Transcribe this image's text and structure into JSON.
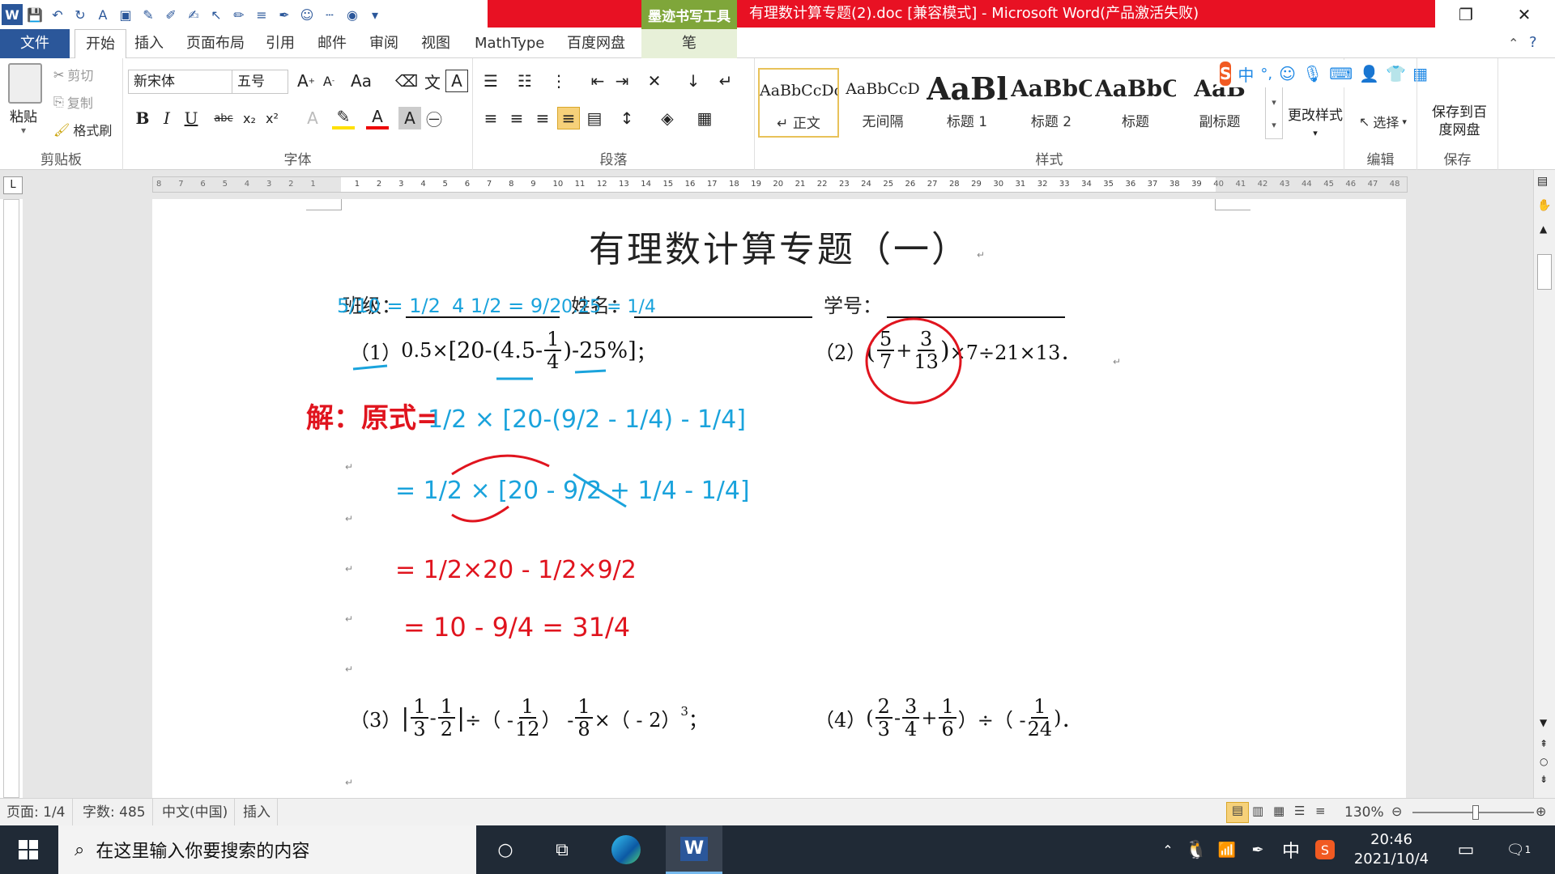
{
  "titlebar": {
    "ink_tools_tab": "墨迹书写工具",
    "doc_title": "有理数计算专题(2).doc [兼容模式] - Microsoft Word(产品激活失败)"
  },
  "tabs": {
    "file": "文件",
    "items": [
      "开始",
      "插入",
      "页面布局",
      "引用",
      "邮件",
      "审阅",
      "视图",
      "MathType",
      "百度网盘"
    ],
    "pen": "笔"
  },
  "ribbon": {
    "clipboard": {
      "paste": "粘贴",
      "cut": "剪切",
      "copy": "复制",
      "format_painter": "格式刷",
      "label": "剪贴板"
    },
    "font": {
      "name": "新宋体",
      "size": "五号",
      "label": "字体"
    },
    "paragraph": {
      "label": "段落"
    },
    "styles": {
      "label": "样式",
      "items": [
        {
          "preview": "AaBbCcDc",
          "name": "↵ 正文"
        },
        {
          "preview": "AaBbCcD",
          "name": "无间隔"
        },
        {
          "preview": "AaBl",
          "name": "标题 1"
        },
        {
          "preview": "AaBbC",
          "name": "标题 2"
        },
        {
          "preview": "AaBbC",
          "name": "标题"
        },
        {
          "preview": "AaB",
          "name": "副标题"
        }
      ],
      "change_styles": "更改样式"
    },
    "editing": {
      "select": "选择",
      "label": "编辑"
    },
    "save": {
      "save_to_baidu": "保存到百度网盘",
      "label": "保存"
    },
    "ime": {
      "mode": "中",
      "punct": "°,"
    }
  },
  "ruler": {
    "ticks": [
      "8",
      "7",
      "6",
      "5",
      "4",
      "3",
      "2",
      "1",
      "",
      "1",
      "2",
      "3",
      "4",
      "5",
      "6",
      "7",
      "8",
      "9",
      "10",
      "11",
      "12",
      "13",
      "14",
      "15",
      "16",
      "17",
      "18",
      "19",
      "20",
      "21",
      "22",
      "23",
      "24",
      "25",
      "26",
      "27",
      "28",
      "29",
      "30",
      "31",
      "32",
      "33",
      "34",
      "35",
      "36",
      "37",
      "38",
      "39",
      "40",
      "41",
      "42",
      "43",
      "44",
      "45",
      "46",
      "47",
      "48"
    ],
    "tab_selector": "L"
  },
  "document": {
    "title": "有理数计算专题（一）",
    "class_label": "班级：",
    "name_label": "姓名：",
    "id_label": "学号：",
    "problem1": {
      "num": "（1）",
      "a": "0.5",
      "op1": "×",
      "b1": "[20-(4.5-",
      "f_n": "1",
      "f_d": "4",
      "b2": ")-25%]",
      "end": "；"
    },
    "problem2": {
      "num": "（2）",
      "f1_n": "5",
      "f1_d": "7",
      "f2_n": "3",
      "f2_d": "13",
      "tail": "×7÷21×13．"
    },
    "problem3": {
      "num": "（3）",
      "a_n": "1",
      "a_d": "3",
      "b_n": "1",
      "b_d": "2",
      "c_n": "1",
      "c_d": "12",
      "d_n": "1",
      "d_d": "8",
      "tail": "×（ - 2）",
      "exp": "3",
      "end": "；"
    },
    "problem4": {
      "num": "（4）",
      "a_n": "2",
      "a_d": "3",
      "b_n": "3",
      "b_d": "4",
      "c_n": "1",
      "c_d": "6",
      "d_n": "1",
      "d_d": "24",
      "end": "．"
    },
    "handwriting": {
      "red_solution": "解：原式=",
      "blue_line1": "1/2 × [20-(9/2 - 1/4) - 1/4]",
      "blue_line2": "= 1/2 × [20 - 9/2 + 1/4 - 1/4]",
      "red_line3": "= 1/2×20 - 1/2×9/2",
      "red_line4": "= 10 - 9/4 = 31/4",
      "blue_ann1": "5/10 = 1/2",
      "blue_ann2": "4 1/2 = 9/2",
      "blue_ann3": "0.25 = 1/4"
    }
  },
  "status": {
    "page": "页面: 1/4",
    "words": "字数: 485",
    "lang": "中文(中国)",
    "mode": "插入",
    "zoom": "130%"
  },
  "taskbar": {
    "search_placeholder": "在这里输入你要搜索的内容",
    "time": "20:46",
    "date": "2021/10/4",
    "ime": "中",
    "notif": "1"
  },
  "colors": {
    "word_blue": "#2b579a",
    "title_red": "#e81123",
    "ink_green": "#7fa63a",
    "ink_red": "#e0141e",
    "ink_blue": "#1aa3dc"
  }
}
